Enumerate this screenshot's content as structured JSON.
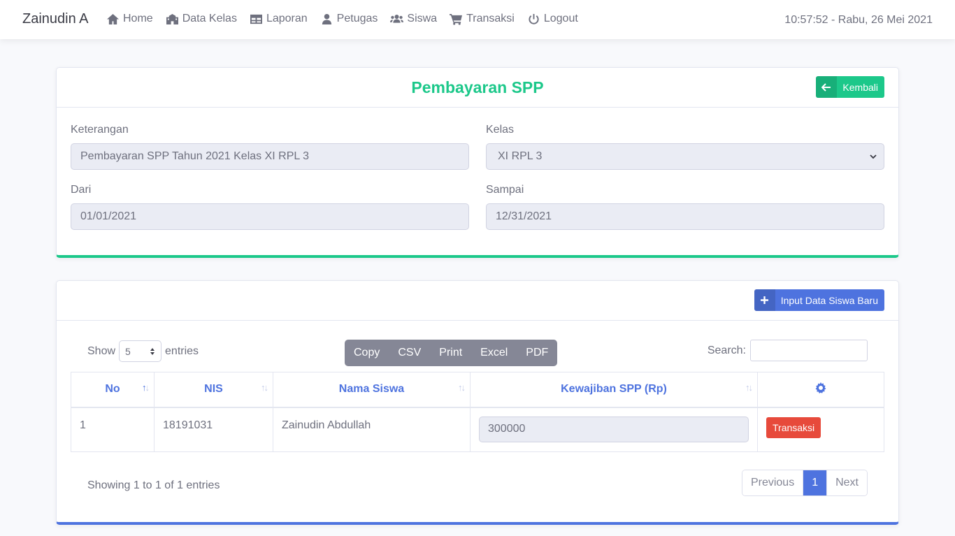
{
  "nav": {
    "brand": "Zainudin A",
    "items": [
      {
        "label": "Home",
        "icon": "home-icon"
      },
      {
        "label": "Data Kelas",
        "icon": "school-icon"
      },
      {
        "label": "Laporan",
        "icon": "table-icon"
      },
      {
        "label": "Petugas",
        "icon": "user-tie-icon"
      },
      {
        "label": "Siswa",
        "icon": "users-icon"
      },
      {
        "label": "Transaksi",
        "icon": "cart-icon"
      },
      {
        "label": "Logout",
        "icon": "power-icon"
      }
    ],
    "clock": "10:57:52 - Rabu, 26 Mei 2021"
  },
  "form": {
    "title": "Pembayaran SPP",
    "back_label": "Kembali",
    "keterangan_label": "Keterangan",
    "keterangan_value": "Pembayaran SPP Tahun 2021 Kelas XI RPL 3",
    "kelas_label": "Kelas",
    "kelas_value": "XI RPL 3",
    "dari_label": "Dari",
    "dari_value": "01/01/2021",
    "sampai_label": "Sampai",
    "sampai_value": "12/31/2021"
  },
  "table_card": {
    "new_label": "Input Data Siswa Baru",
    "show_label": "Show",
    "entries_label": "entries",
    "length_value": "5",
    "export_buttons": [
      "Copy",
      "CSV",
      "Print",
      "Excel",
      "PDF"
    ],
    "search_label": "Search:",
    "columns": [
      "No",
      "NIS",
      "Nama Siswa",
      "Kewajiban SPP (Rp)"
    ],
    "rows": [
      {
        "no": "1",
        "nis": "18191031",
        "nama": "Zainudin Abdullah",
        "kewajiban": "300000",
        "action": "Transaksi"
      }
    ],
    "info": "Showing 1 to 1 of 1 entries",
    "pager": {
      "prev": "Previous",
      "current": "1",
      "next": "Next"
    }
  },
  "colors": {
    "success": "#1cc88a",
    "primary": "#4e73df",
    "danger": "#e74a3b",
    "secondary": "#858796"
  }
}
